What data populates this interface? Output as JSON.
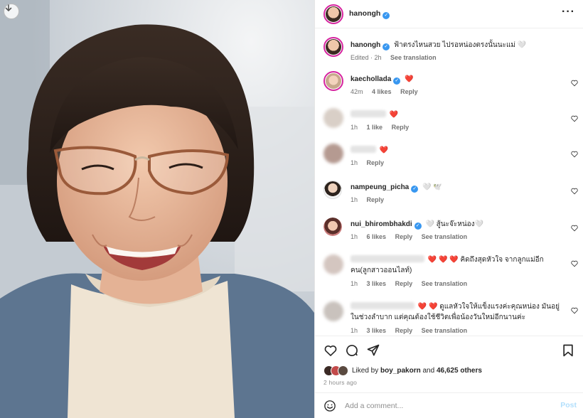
{
  "photo": {
    "description_icon": "download-arrow-icon"
  },
  "header": {
    "username": "hanongh",
    "more_icon": "ellipsis-icon"
  },
  "caption": {
    "username": "hanongh",
    "text": "ฟ้าตรงไหนสวย ไปรอหน่องตรงนั้นนะแม่ 🤍",
    "edited": "Edited · 2h",
    "translate": "See translation"
  },
  "comments": [
    {
      "username": "kaechollada",
      "text": "❤️",
      "time": "42m",
      "likes": "4 likes",
      "reply": "Reply",
      "verified": true
    },
    {
      "username": "",
      "text": "❤️",
      "time": "1h",
      "likes": "1 like",
      "reply": "Reply"
    },
    {
      "username": "",
      "text": "❤️",
      "time": "1h",
      "likes": "",
      "reply": "Reply"
    },
    {
      "username": "nampeung_picha",
      "text": "🤍 🕊️",
      "time": "1h",
      "likes": "",
      "reply": "Reply",
      "verified": true
    },
    {
      "username": "nui_bhirombhakdi",
      "text": "🤍 สู้นะจ๊ะหน่อง🤍",
      "time": "1h",
      "likes": "6 likes",
      "reply": "Reply",
      "translate": "See translation",
      "verified": true
    },
    {
      "username": "",
      "text": "❤️ ❤️ ❤️ คิดถึงสุดหัวใจ จากลูกแม่อีกคน(ลูกสาวออนไลท์)",
      "time": "1h",
      "likes": "3 likes",
      "reply": "Reply",
      "translate": "See translation"
    },
    {
      "username": "",
      "text": "❤️ ❤️ ดูแลหัวใจให้แข็งแรงค่ะคุณหน่อง มันอยู่ในช่วงลำบาก แต่คุณต้องใช้ชีวิตเพื่อน้องวันใหม่อีกนานค่ะ",
      "time": "1h",
      "likes": "3 likes",
      "reply": "Reply",
      "translate": "See translation"
    }
  ],
  "actions": {
    "liked_prefix": "Liked by",
    "liked_user": "boy_pakorn",
    "liked_and": "and",
    "liked_count": "46,625 others",
    "time_ago": "2 hours ago"
  },
  "add_comment": {
    "placeholder": "Add a comment...",
    "post_label": "Post"
  },
  "colors": {
    "verified": "#3897f0",
    "heart": "#ed4956",
    "link_disabled": "#b2dffc",
    "story_ring": "#d6249f"
  }
}
